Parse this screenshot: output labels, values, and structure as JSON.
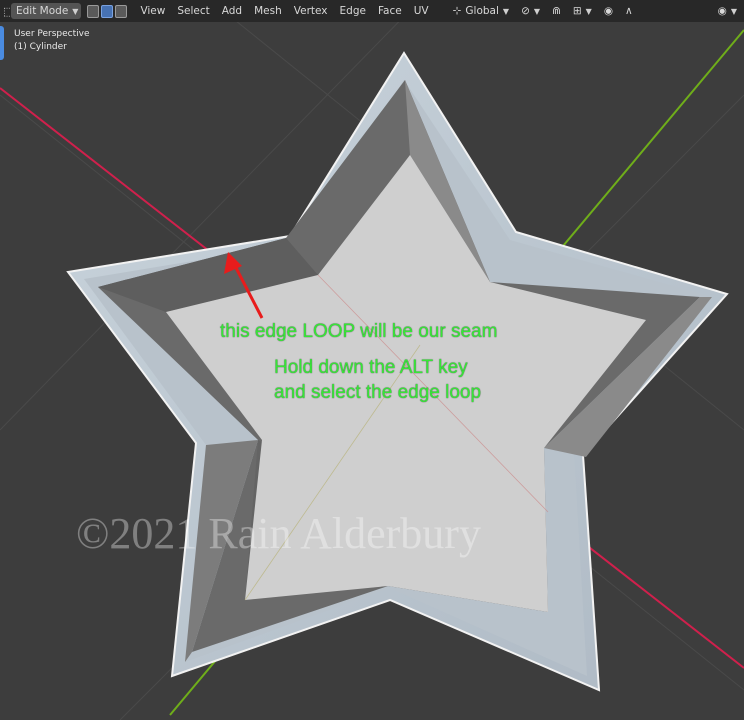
{
  "header": {
    "mode_label": "Edit Mode",
    "menu": [
      "View",
      "Select",
      "Add",
      "Mesh",
      "Vertex",
      "Edge",
      "Face",
      "UV"
    ],
    "orientation_label": "Global"
  },
  "viewport_info": {
    "perspective": "User Perspective",
    "object": "(1) Cylinder"
  },
  "annotations": {
    "seam_note": "this edge LOOP will be our seam",
    "instruction_line1": "Hold down the ALT key",
    "instruction_line2": "and select the edge loop",
    "arrow_color": "#e81c1c",
    "text_color": "#37e637"
  },
  "watermark": "©2021 Rain Alderbury",
  "icons": {
    "mode_dropdown": "chevron-down-icon",
    "vertex_select": "vertex-select-icon",
    "edge_select": "edge-select-icon",
    "face_select": "face-select-icon",
    "transform_orientation": "global-orientation-icon",
    "snap": "magnet-icon",
    "proportional": "proportional-edit-icon",
    "overlays": "eye-icon"
  },
  "colors": {
    "x_axis": "#d0204c",
    "y_axis": "#6fae1a",
    "viewport_bg": "#3d3d3d",
    "header_bg": "#262626"
  }
}
